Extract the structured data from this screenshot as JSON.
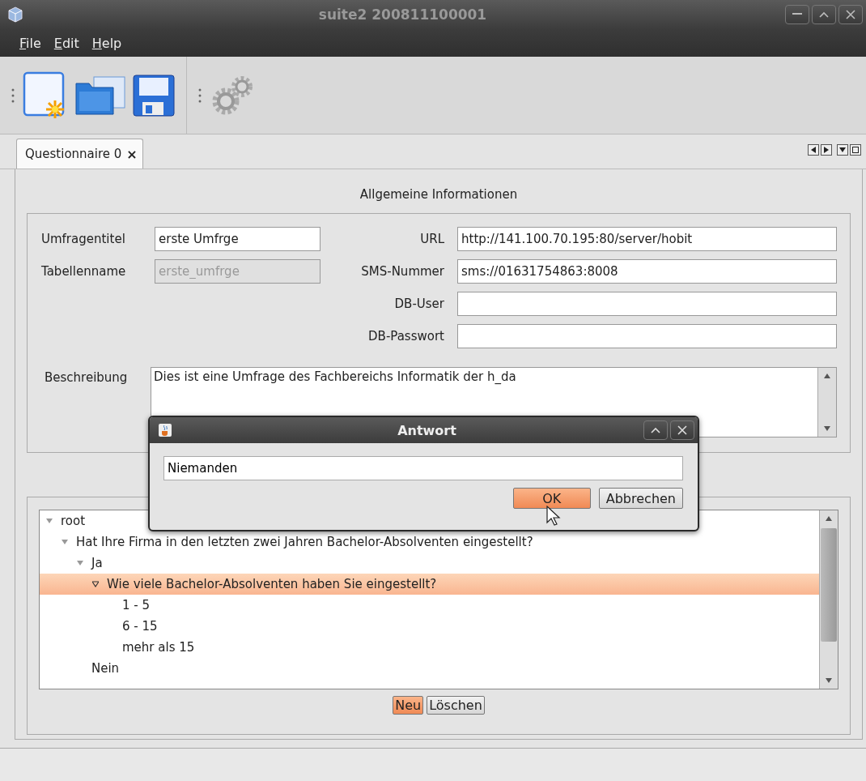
{
  "window": {
    "title": "suite2 200811100001"
  },
  "menu": [
    {
      "label": "File"
    },
    {
      "label": "Edit"
    },
    {
      "label": "Help"
    }
  ],
  "tabs": [
    {
      "label": "Questionnaire 0",
      "close": "×",
      "selected": true
    }
  ],
  "general": {
    "title": "Allgemeine Informationen",
    "left_fields": [
      {
        "label": "Umfragentitel",
        "value": "erste Umfrge",
        "disabled": false
      },
      {
        "label": "Tabellenname",
        "value": "erste_umfrge",
        "disabled": true
      }
    ],
    "right_fields": [
      {
        "label": "URL",
        "value": "http://141.100.70.195:80/server/hobit",
        "disabled": false
      },
      {
        "label": "SMS-Nummer",
        "value": "sms://01631754863:8008",
        "disabled": false
      },
      {
        "label": "DB-User",
        "disabled": false
      },
      {
        "label": "DB-Passwort",
        "disabled": false
      }
    ],
    "description": {
      "label": "Beschreibung",
      "value": "Dies ist eine Umfrage des Fachbereichs Informatik der h_da"
    }
  },
  "tree": [
    {
      "label": "root",
      "expanded": true,
      "selected": false,
      "children": [
        {
          "label": "Hat Ihre Firma in den letzten zwei Jahren Bachelor-Absolventen eingestellt?",
          "expanded": true,
          "selected": false,
          "children": [
            {
              "label": "Ja",
              "expanded": true,
              "selected": false,
              "children": [
                {
                  "label": "Wie viele Bachelor-Absolventen haben Sie eingestellt?",
                  "expanded": true,
                  "selected": true,
                  "children": [
                    {
                      "label": "1 - 5",
                      "selected": false
                    },
                    {
                      "label": "6 - 15",
                      "selected": false
                    },
                    {
                      "label": "mehr als 15",
                      "selected": false
                    }
                  ]
                }
              ]
            },
            {
              "label": "Nein",
              "selected": false
            }
          ]
        }
      ]
    }
  ],
  "tree_buttons": [
    {
      "label": "Neu",
      "highlighted": true
    },
    {
      "label": "Löschen",
      "highlighted": false
    }
  ],
  "dialog": {
    "title": "Antwort",
    "value": "Niemanden",
    "buttons": [
      {
        "label": "OK",
        "highlighted": true
      },
      {
        "label": "Abbrechen",
        "highlighted": false
      }
    ]
  }
}
